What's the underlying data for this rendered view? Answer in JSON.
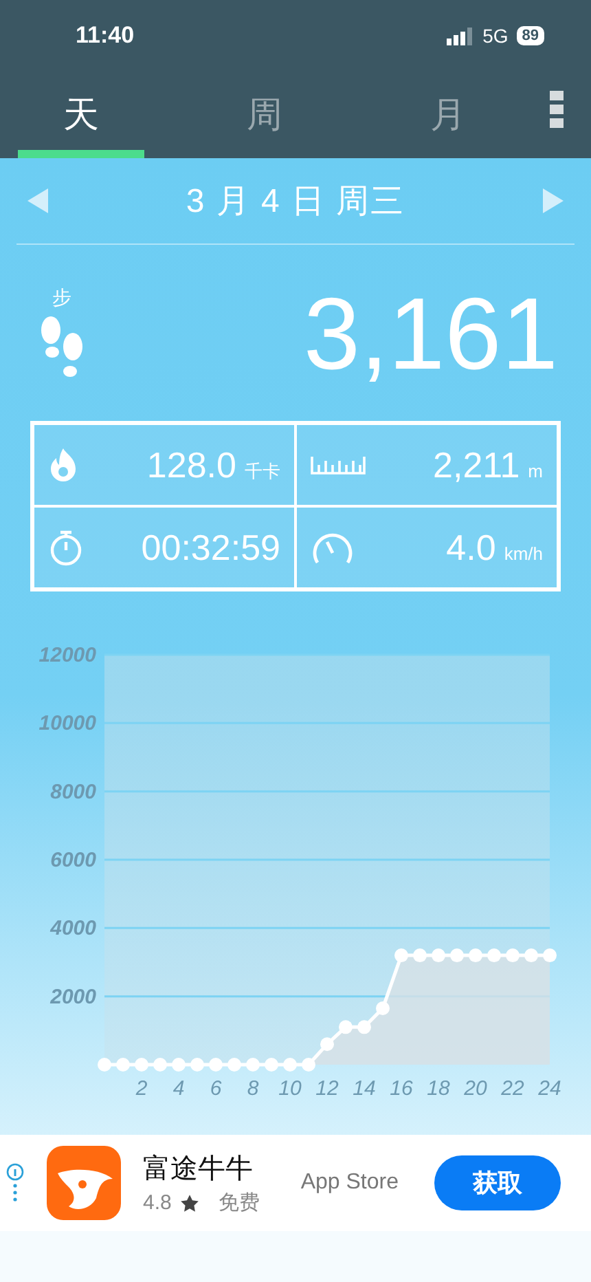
{
  "status_bar": {
    "time": "11:40",
    "network": "5G",
    "battery": "89"
  },
  "tabs": [
    {
      "label": "天",
      "selected": true
    },
    {
      "label": "周",
      "selected": false
    },
    {
      "label": "月",
      "selected": false
    }
  ],
  "date": "3 月 4 日 周三",
  "steps": {
    "unit": "步",
    "value": "3,161"
  },
  "stats": [
    {
      "kind": "calories",
      "value": "128.0",
      "unit": "千卡"
    },
    {
      "kind": "distance",
      "value": "2,211",
      "unit": "m"
    },
    {
      "kind": "time",
      "value": "00:32:59"
    },
    {
      "kind": "speed",
      "value": "4.0",
      "unit": "km/h"
    }
  ],
  "chart": {
    "chart_data": {
      "type": "area",
      "x": [
        0,
        1,
        2,
        3,
        4,
        5,
        6,
        7,
        8,
        9,
        10,
        11,
        12,
        13,
        14,
        15,
        16,
        17,
        18,
        19,
        20,
        21,
        22,
        23,
        24
      ],
      "values": [
        0,
        0,
        0,
        0,
        0,
        0,
        0,
        0,
        0,
        0,
        0,
        0,
        600,
        1100,
        1100,
        1650,
        3200,
        3200,
        3200,
        3200,
        3200,
        3200,
        3200,
        3200,
        3200
      ],
      "grid": true,
      "xlim": [
        0,
        24
      ],
      "ylim": [
        0,
        12000
      ],
      "xticks": [
        2,
        4,
        6,
        8,
        10,
        12,
        14,
        16,
        18,
        20,
        22,
        24
      ],
      "yticks": [
        2000,
        4000,
        6000,
        8000,
        10000,
        12000
      ]
    }
  },
  "ad": {
    "app_name": "富途牛牛",
    "rating": "4.8",
    "price": "免费",
    "store": "App Store",
    "button": "获取"
  }
}
